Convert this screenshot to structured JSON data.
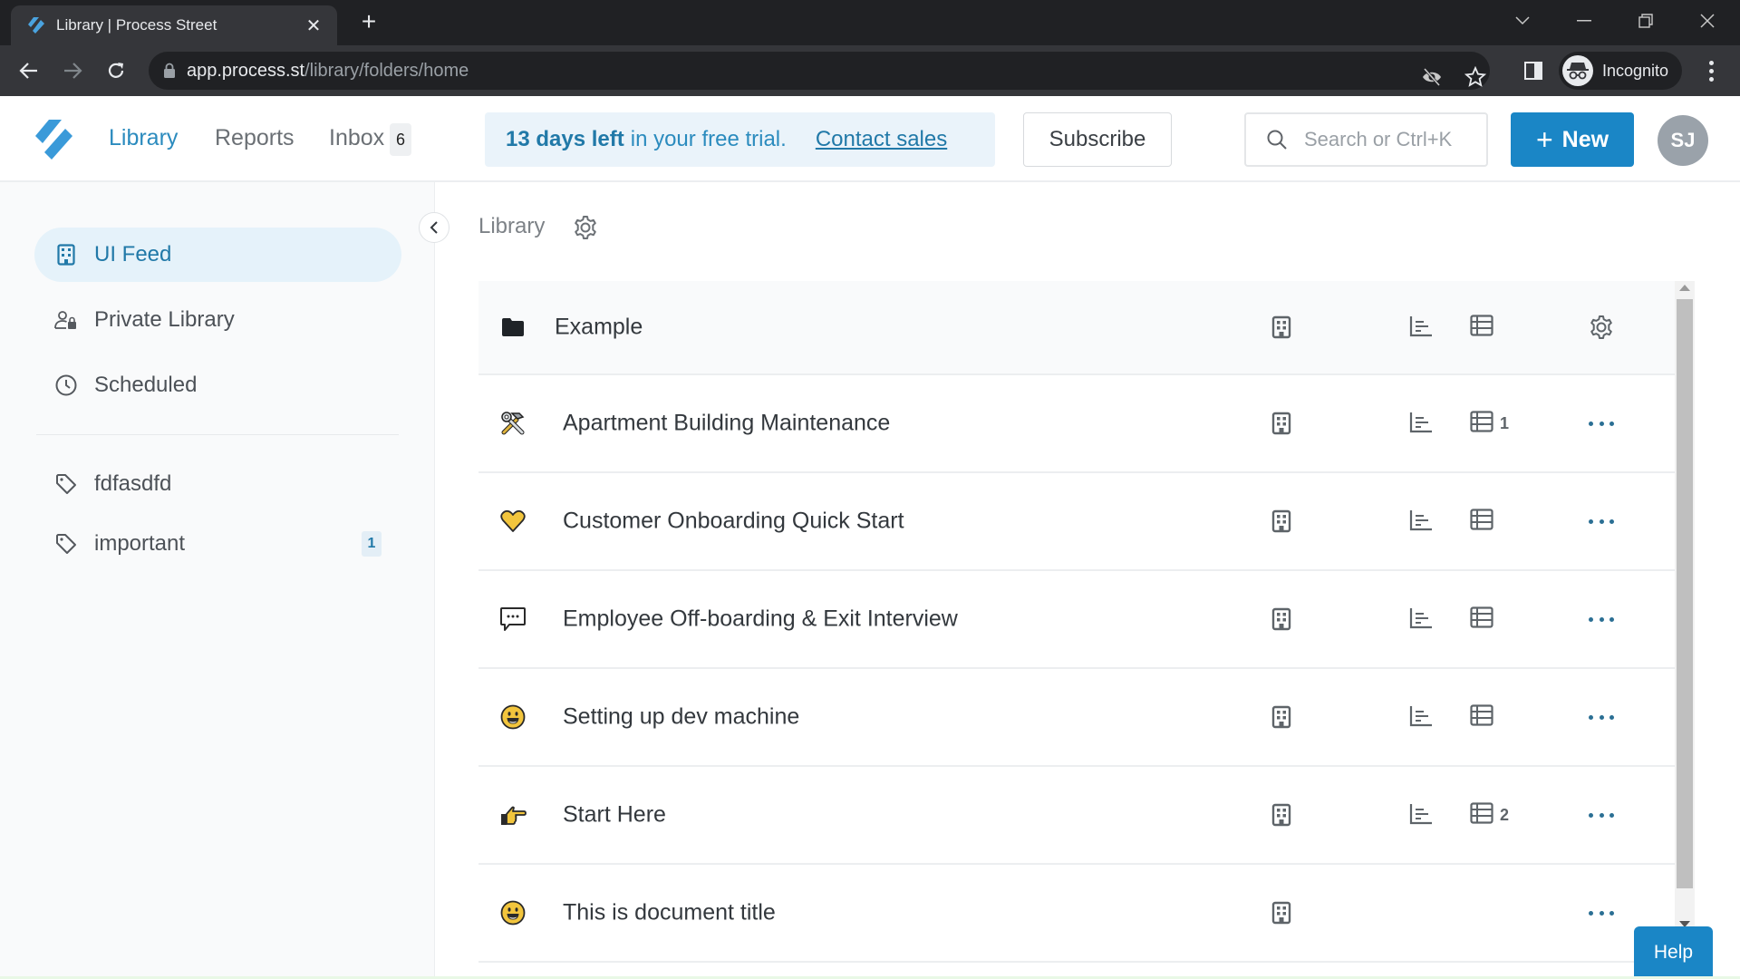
{
  "browser": {
    "tab_title": "Library | Process Street",
    "url_host": "app.process.st",
    "url_path": "/library/folders/home",
    "profile_label": "Incognito"
  },
  "header": {
    "nav": [
      {
        "label": "Library",
        "active": true
      },
      {
        "label": "Reports",
        "active": false
      },
      {
        "label": "Inbox",
        "active": false
      }
    ],
    "inbox_count": "6",
    "trial": {
      "bold": "13 days left",
      "rest": "in your free trial.",
      "link": "Contact sales"
    },
    "subscribe_label": "Subscribe",
    "search_placeholder": "Search or Ctrl+K",
    "new_label": "New",
    "avatar_initials": "SJ",
    "colors": {
      "accent": "#1a86c6",
      "link": "#2179a8",
      "trial_bg": "#eaf3fa"
    }
  },
  "sidebar": {
    "items": [
      {
        "label": "UI Feed",
        "icon": "building-icon",
        "active": true
      },
      {
        "label": "Private Library",
        "icon": "user-lock-icon",
        "active": false
      },
      {
        "label": "Scheduled",
        "icon": "clock-icon",
        "active": false
      }
    ],
    "tags": [
      {
        "label": "fdfasdfd",
        "icon": "tag-icon",
        "count": null
      },
      {
        "label": "important",
        "icon": "tag-icon",
        "count": "1"
      }
    ]
  },
  "main": {
    "breadcrumb": "Library",
    "rows": [
      {
        "type": "folder",
        "icon": "folder-icon",
        "emoji": "",
        "title": "Example",
        "table_count": "",
        "action": "gear"
      },
      {
        "type": "workflow",
        "icon": "hammer-wrench-icon",
        "emoji": "🛠",
        "title": "Apartment Building Maintenance",
        "table_count": "1",
        "action": "more"
      },
      {
        "type": "workflow",
        "icon": "heart-icon",
        "emoji": "💛",
        "title": "Customer Onboarding Quick Start",
        "table_count": "",
        "action": "more"
      },
      {
        "type": "workflow",
        "icon": "speech-bubble-icon",
        "emoji": "",
        "title": "Employee Off-boarding & Exit Interview",
        "table_count": "",
        "action": "more"
      },
      {
        "type": "workflow",
        "icon": "smiley-icon",
        "emoji": "😀",
        "title": "Setting up dev machine",
        "table_count": "",
        "action": "more"
      },
      {
        "type": "workflow",
        "icon": "pointing-hand-icon",
        "emoji": "👉",
        "title": "Start Here",
        "table_count": "2",
        "action": "more"
      },
      {
        "type": "page",
        "icon": "smiley-icon",
        "emoji": "😀",
        "title": "This is document title",
        "table_count": "",
        "action": "more",
        "no_reports": true
      }
    ]
  },
  "help_label": "Help"
}
